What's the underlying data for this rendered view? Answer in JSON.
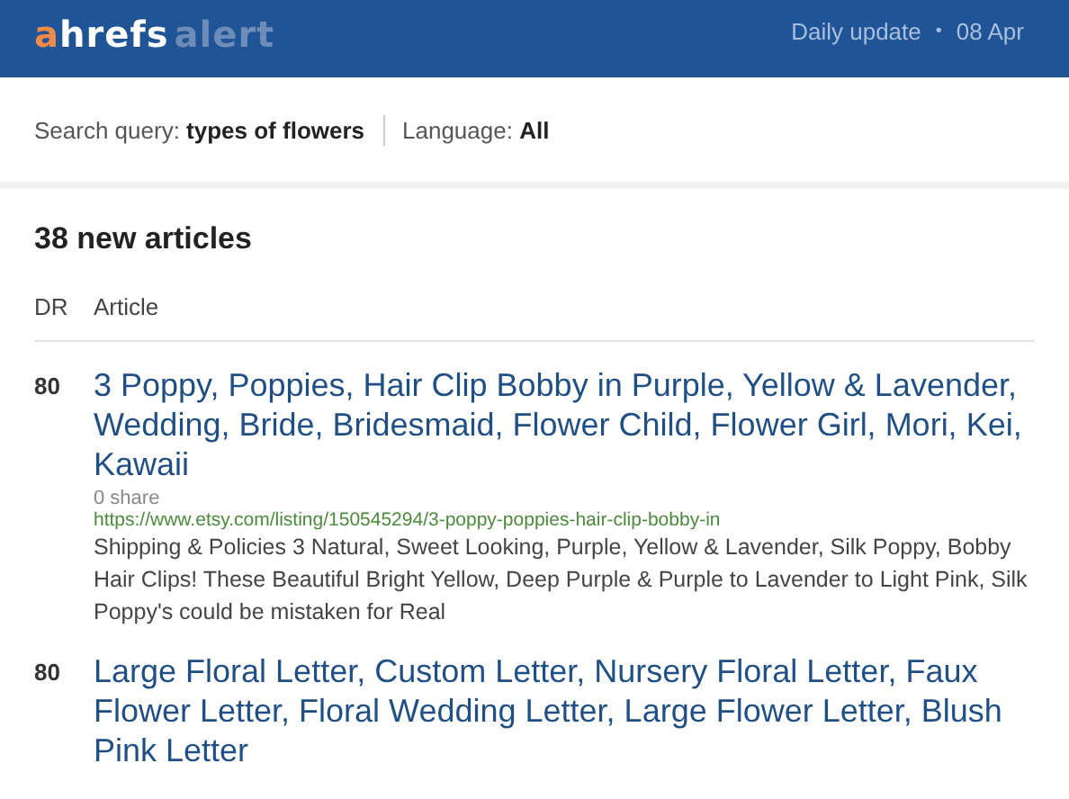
{
  "header": {
    "logo": {
      "brand": "ahrefs",
      "product": "alert"
    },
    "frequency": "Daily update",
    "separator": "•",
    "date": "08 Apr"
  },
  "filters": [
    {
      "label": "Search query:",
      "value": "types of flowers"
    },
    {
      "label": "Language:",
      "value": "All"
    }
  ],
  "heading": "38 new articles",
  "columns": [
    "DR",
    "Article"
  ],
  "articles": [
    {
      "dr": "80",
      "title": "3 Poppy, Poppies, Hair Clip Bobby in Purple, Yellow & Lavender, Wedding, Bride, Bridesmaid, Flower Child, Flower Girl, Mori, Kei, Kawaii",
      "shares": "0 share",
      "url": "https://www.etsy.com/listing/150545294/3-poppy-poppies-hair-clip-bobby-in",
      "snippet": "Shipping & Policies 3 Natural, Sweet Looking, Purple, Yellow & Lavender, Silk Poppy, Bobby Hair Clips! These Beautiful Bright Yellow, Deep Purple & Purple to Lavender to Light Pink, Silk Poppy's could be mistaken for Real"
    },
    {
      "dr": "80",
      "title": "Large Floral Letter, Custom Letter, Nursery Floral Letter, Faux Flower Letter, Floral Wedding Letter, Large Flower Letter, Blush Pink Letter"
    }
  ]
}
